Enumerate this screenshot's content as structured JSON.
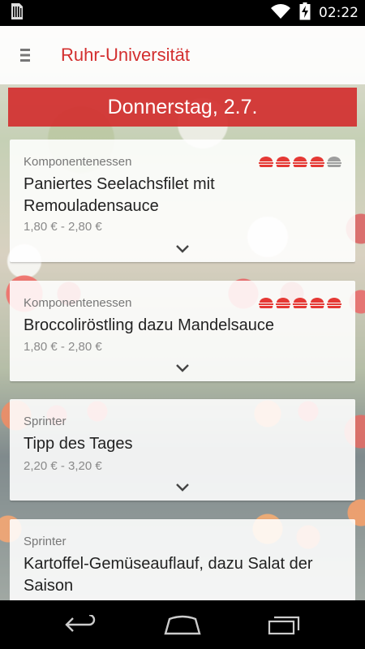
{
  "status_bar": {
    "time": "02:22",
    "icons": [
      "sim-card-icon",
      "wifi-icon",
      "battery-charging-icon"
    ]
  },
  "app_bar": {
    "menu_icon": "hamburger-menu-icon",
    "title": "Ruhr-Universität"
  },
  "date_banner": {
    "label": "Donnerstag, 2.7."
  },
  "colors": {
    "accent": "#d32f2f",
    "rating_active": "#e53935",
    "rating_inactive": "#9e9e9e"
  },
  "meals": [
    {
      "category": "Komponentenessen",
      "name": "Paniertes Seelachsfilet mit Remouladensauce",
      "price": "1,80 € - 2,80 €",
      "rating": 4,
      "rating_max": 5,
      "expand_icon": "chevron-down-icon"
    },
    {
      "category": "Komponentenessen",
      "name": "Broccoliröstling dazu Mandelsauce",
      "price": "1,80 € - 2,80 €",
      "rating": 5,
      "rating_max": 5,
      "expand_icon": "chevron-down-icon"
    },
    {
      "category": "Sprinter",
      "name": "Tipp des Tages",
      "price": "2,20 € - 3,20 €",
      "expand_icon": "chevron-down-icon"
    },
    {
      "category": "Sprinter",
      "name": "Kartoffel-Gemüseauflauf, dazu Salat der Saison"
    }
  ],
  "nav_bar": {
    "buttons": [
      "back-icon",
      "home-icon",
      "recent-apps-icon"
    ]
  }
}
